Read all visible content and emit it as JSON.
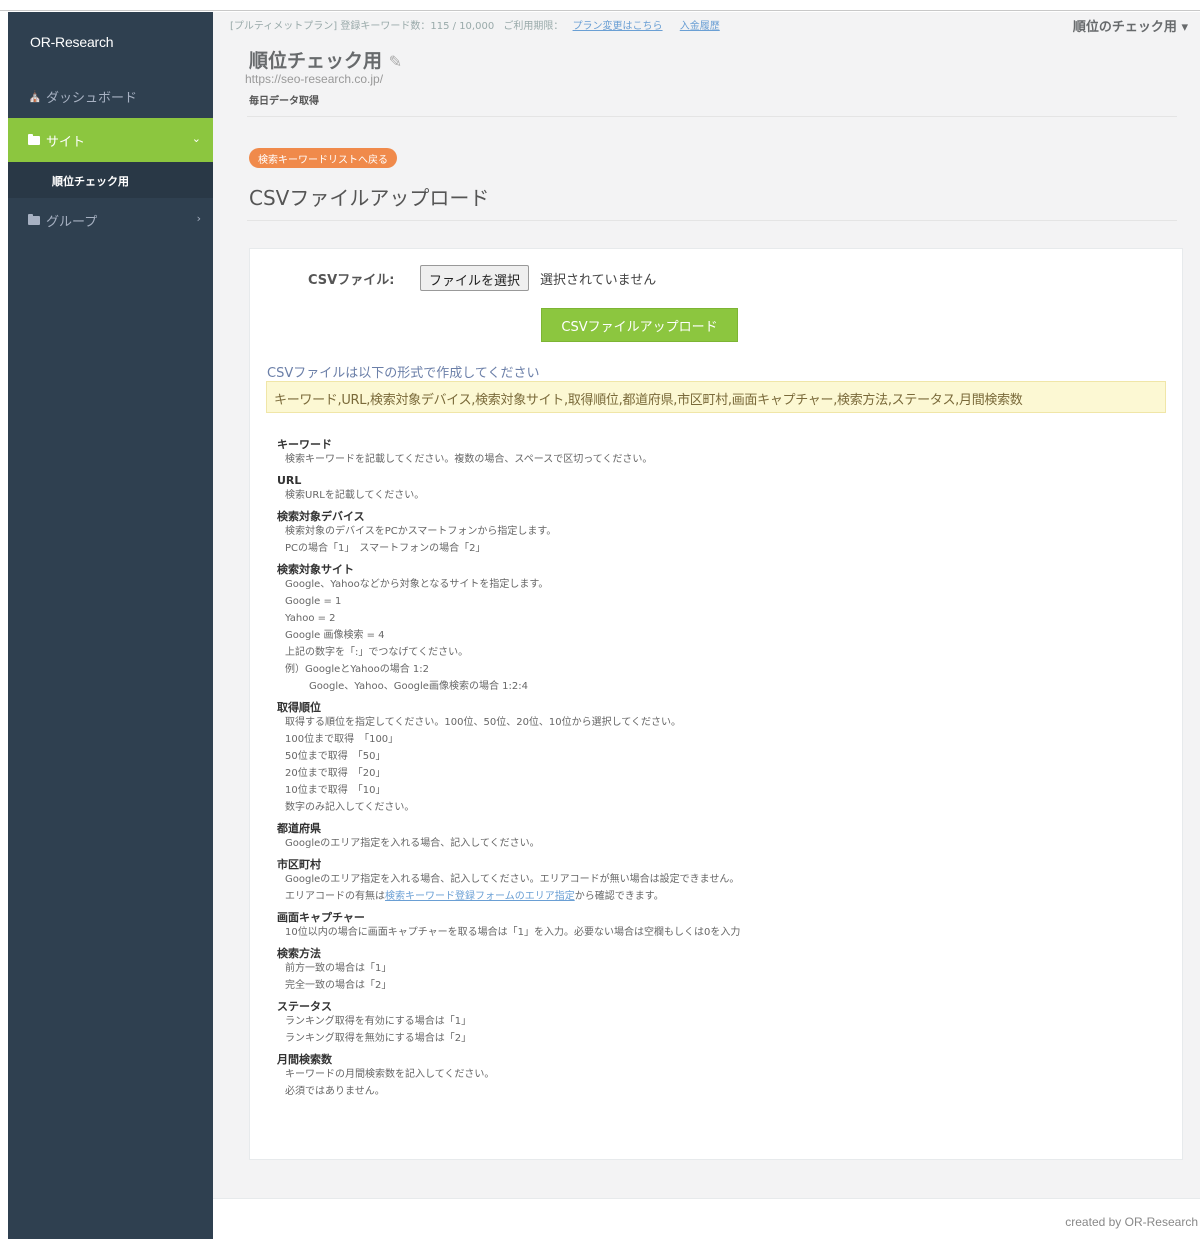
{
  "sidebar": {
    "brand": "OR-Research",
    "dashboard_label": "ダッシュボード",
    "site_label": "サイト",
    "site_sub_label": "順位チェック用",
    "group_label": "グループ"
  },
  "topbar": {
    "plan_info": "[プルティメットプラン] 登録キーワード数：115 / 10,000",
    "contract_label": "ご利用期限：",
    "plan_change_link": "プラン変更はこちら",
    "other_link": "入金履歴",
    "user_name": "順位のチェック用"
  },
  "header": {
    "site_title": "順位チェック用",
    "site_url": "https://seo-research.co.jp/",
    "site_sub": "毎日データ取得"
  },
  "page": {
    "back_button": "検索キーワードリストへ戻る",
    "title": "CSVファイルアップロード"
  },
  "upload_form": {
    "file_label": "CSVファイル:",
    "file_button": "ファイルを選択",
    "file_status": "選択されていません",
    "upload_button": "CSVファイルアップロード"
  },
  "format": {
    "lead": "CSVファイルは以下の形式で作成してください",
    "columns": "キーワード,URL,検索対象デバイス,検索対象サイト,取得順位,都道府県,市区町村,画面キャプチャー,検索方法,ステータス,月間検索数"
  },
  "descriptions": {
    "keyword": {
      "title": "キーワード",
      "lines": [
        "検索キーワードを記載してください。複数の場合、スペースで区切ってください。"
      ]
    },
    "url": {
      "title": "URL",
      "lines": [
        "検索URLを記載してください。"
      ]
    },
    "device": {
      "title": "検索対象デバイス",
      "lines": [
        "検索対象のデバイスをPCかスマートフォンから指定します。",
        "PCの場合「1」　スマートフォンの場合「2」"
      ]
    },
    "site": {
      "title": "検索対象サイト",
      "lines": [
        "Google、Yahooなどから対象となるサイトを指定します。",
        "Google = 1",
        "Yahoo = 2",
        "Google 画像検索 = 4",
        "上記の数字を「:」でつなげてください。",
        "例）GoogleとYahooの場合 1:2"
      ],
      "example2": "Google、Yahoo、Google画像検索の場合 1:2:4"
    },
    "rank": {
      "title": "取得順位",
      "lines": [
        "取得する順位を指定してください。100位、50位、20位、10位から選択してください。",
        "100位まで取得　「100」",
        "50位まで取得　「50」",
        "20位まで取得　「20」",
        "10位まで取得　「10」",
        "数字のみ記入してください。"
      ]
    },
    "prefecture": {
      "title": "都道府県",
      "lines": [
        "Googleのエリア指定を入れる場合、記入してください。"
      ]
    },
    "city": {
      "title": "市区町村",
      "lines": [
        "Googleのエリア指定を入れる場合、記入してください。エリアコードが無い場合は設定できません。"
      ],
      "line2_prefix": "エリアコードの有無は",
      "line2_link": "検索キーワード登録フォームのエリア指定",
      "line2_suffix": "から確認できます。"
    },
    "capture": {
      "title": "画面キャプチャー",
      "lines": [
        "10位以内の場合に画面キャプチャーを取る場合は「1」を入力。必要ない場合は空欄もしくは0を入力"
      ]
    },
    "method": {
      "title": "検索方法",
      "lines": [
        "前方一致の場合は「1」",
        "完全一致の場合は「2」"
      ]
    },
    "status": {
      "title": "ステータス",
      "lines": [
        "ランキング取得を有効にする場合は「1」",
        "ランキング取得を無効にする場合は「2」"
      ]
    },
    "monthly": {
      "title": "月間検索数",
      "lines": [
        "キーワードの月間検索数を記入してください。",
        "必須ではありません。"
      ]
    }
  },
  "footer": {
    "credit": "created by OR-Research"
  },
  "colors": {
    "sidebar": "#2f4050",
    "accent_green": "#8cc63f",
    "accent_orange": "#f08a4b",
    "format_bg": "#fcf8d3"
  }
}
